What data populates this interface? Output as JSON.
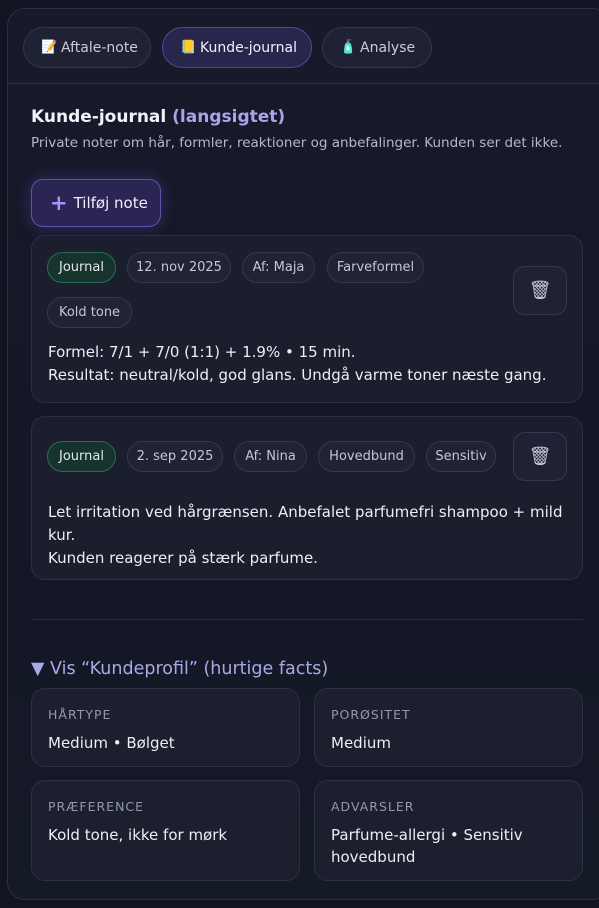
{
  "tabs": [
    {
      "icon": "📝",
      "label": "Aftale-note"
    },
    {
      "icon": "📒",
      "label": "Kunde-journal"
    },
    {
      "icon": "🧴",
      "label": "Analyse"
    }
  ],
  "section": {
    "title": "Kunde-journal",
    "title_suffix": "(langsigtet)",
    "description": "Private noter om hår, formler, reaktioner og anbefalinger. Kunden ser det ikke.",
    "add_button": "Tilføj note"
  },
  "notes": [
    {
      "type": "Journal",
      "date": "12. nov 2025",
      "author": "Af: Maja",
      "tags": [
        "Farveformel",
        "Kold tone"
      ],
      "lines": [
        "Formel: 7/1 + 7/0 (1:1) + 1.9% • 15 min.",
        "Resultat: neutral/kold, god glans. Undgå varme toner næste gang."
      ]
    },
    {
      "type": "Journal",
      "date": "2. sep 2025",
      "author": "Af: Nina",
      "tags": [
        "Hovedbund",
        "Sensitiv"
      ],
      "lines": [
        "Let irritation ved hårgrænsen. Anbefalet parfumefri shampoo + mild",
        "kur.",
        "Kunden reagerer på stærk parfume."
      ]
    }
  ],
  "profile": {
    "toggle": "▼ Vis “Kundeprofil” (hurtige facts)",
    "facts": [
      {
        "key": "HÅRTYPE",
        "value": "Medium • Bølget"
      },
      {
        "key": "PORØSITET",
        "value": "Medium"
      },
      {
        "key": "PRÆFERENCE",
        "value": "Kold tone, ikke for mørk"
      },
      {
        "key": "ADVARSLER",
        "value": "Parfume-allergi • Sensitiv hovedbund"
      }
    ]
  },
  "icons": {
    "trash": "trash-icon",
    "plus": "plus-icon"
  },
  "colors": {
    "accent": "#a8a4ea",
    "journal_chip": "#17332d",
    "background": "#121421"
  }
}
